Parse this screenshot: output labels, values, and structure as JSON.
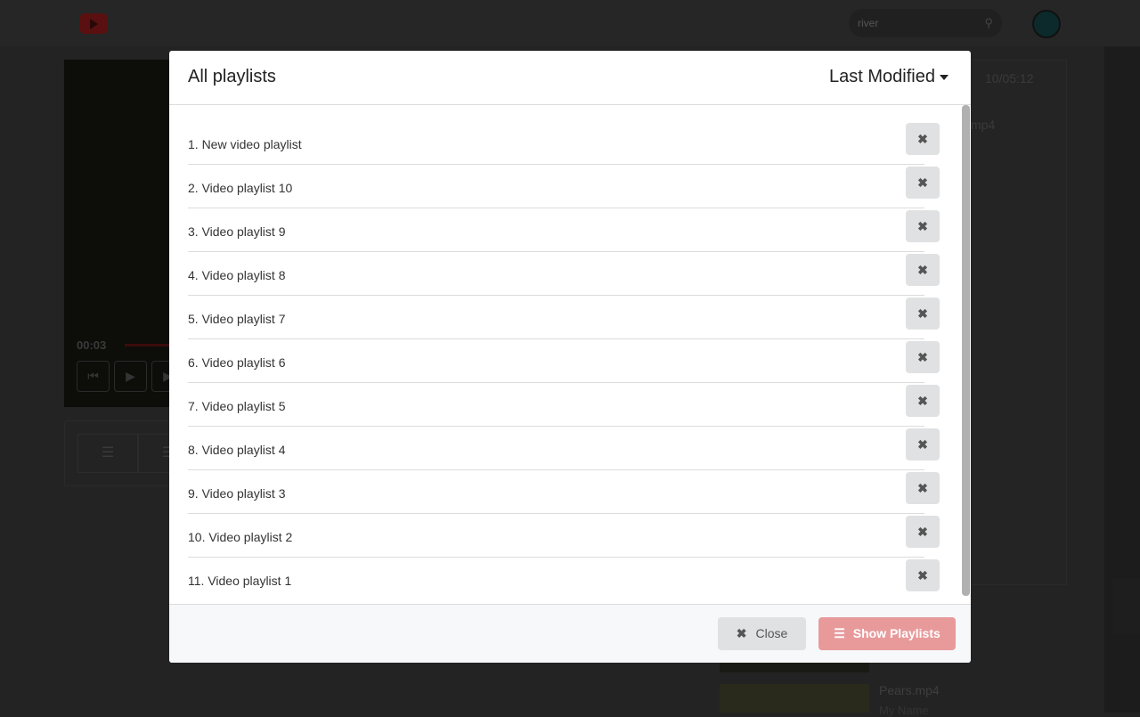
{
  "header": {
    "search_value": "river"
  },
  "player": {
    "time": "00:03"
  },
  "side": {
    "timestamp": "10/05:12",
    "file_partial": "mp4",
    "video_title": "Pears.mp4",
    "video_author": "My Name"
  },
  "modal": {
    "title": "All playlists",
    "sort_label": "Last Modified",
    "playlists": [
      {
        "label": "1. New video playlist"
      },
      {
        "label": "2. Video playlist 10"
      },
      {
        "label": "3. Video playlist 9"
      },
      {
        "label": "4. Video playlist 8"
      },
      {
        "label": "5. Video playlist 7"
      },
      {
        "label": "6. Video playlist 6"
      },
      {
        "label": "7. Video playlist 5"
      },
      {
        "label": "8. Video playlist 4"
      },
      {
        "label": "9. Video playlist 3"
      },
      {
        "label": "10. Video playlist 2"
      },
      {
        "label": "11. Video playlist 1"
      }
    ],
    "close_label": "Close",
    "show_label": "Show Playlists"
  },
  "colors": {
    "primary_disabled": "#e89a9b",
    "overlay": "#232323"
  }
}
